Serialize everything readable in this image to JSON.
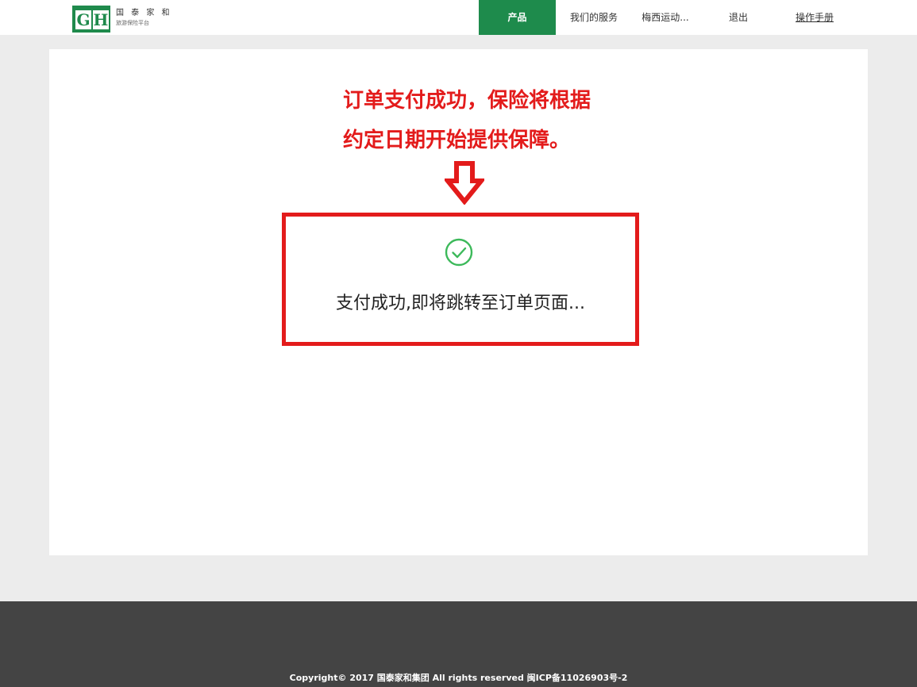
{
  "header": {
    "logo": {
      "mark_left": "G",
      "mark_right": "H",
      "name": "国 泰 家 和",
      "tagline": "旅游保险平台"
    },
    "nav": {
      "product": "产品",
      "services": "我们的服务",
      "user": "梅西运动...",
      "logout": "退出",
      "manual": "操作手册"
    }
  },
  "annotation": {
    "line1": "订单支付成功，保险将根据",
    "line2": "约定日期开始提供保障。"
  },
  "status": {
    "icon": "check-circle-icon",
    "message": "支付成功,即将跳转至订单页面..."
  },
  "footer": {
    "copyright": "Copyright© 2017 国泰家和集团 All rights reserved 闽ICP备11026903号-2"
  },
  "colors": {
    "brand_green": "#1e8b4c",
    "annotation_red": "#e31b1b",
    "success_green": "#3cb95a",
    "footer_bg": "#444444"
  }
}
